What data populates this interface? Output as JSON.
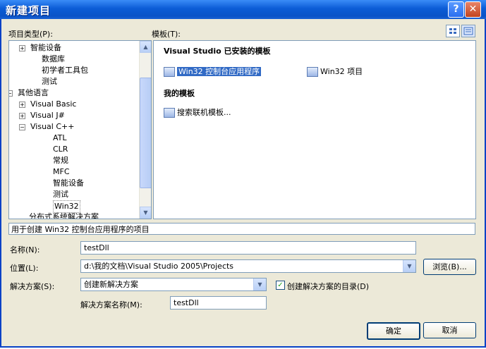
{
  "window": {
    "title": "新建项目",
    "help_symbol": "?",
    "close_symbol": "✕"
  },
  "labels": {
    "project_types": "项目类型(P):",
    "templates": "模板(T):"
  },
  "tree": [
    {
      "label": "智能设备",
      "expander": "+"
    },
    {
      "label": "数据库",
      "expander": ""
    },
    {
      "label": "初学者工具包",
      "expander": ""
    },
    {
      "label": "测试",
      "expander": ""
    },
    {
      "label": "其他语言",
      "expander": "−"
    },
    {
      "label": "Visual Basic",
      "expander": "+"
    },
    {
      "label": "Visual J#",
      "expander": "+"
    },
    {
      "label": "Visual C++",
      "expander": "−"
    },
    {
      "label": "ATL",
      "expander": ""
    },
    {
      "label": "CLR",
      "expander": ""
    },
    {
      "label": "常规",
      "expander": ""
    },
    {
      "label": "MFC",
      "expander": ""
    },
    {
      "label": "智能设备",
      "expander": ""
    },
    {
      "label": "测试",
      "expander": ""
    },
    {
      "label": "Win32",
      "expander": ""
    },
    {
      "label": "分布式系统解决方案",
      "expander": ""
    }
  ],
  "templates": {
    "installed_header": "Visual Studio 已安装的模板",
    "installed": [
      {
        "label": "Win32 控制台应用程序",
        "icon": "console-app-icon",
        "selected": true
      },
      {
        "label": "Win32 项目",
        "icon": "win32-project-icon",
        "selected": false
      }
    ],
    "my_header": "我的模板",
    "my": [
      {
        "label": "搜索联机模板...",
        "icon": "search-online-icon"
      }
    ]
  },
  "description": "用于创建 Win32 控制台应用程序的项目",
  "form": {
    "name_label": "名称(N):",
    "name_value": "testDll",
    "location_label": "位置(L):",
    "location_value": "d:\\我的文档\\Visual Studio 2005\\Projects",
    "browse_label": "浏览(B)...",
    "solution_label": "解决方案(S):",
    "solution_value": "创建新解决方案",
    "create_dir_label": "创建解决方案的目录(D)",
    "create_dir_checked": true,
    "solution_name_label": "解决方案名称(M):",
    "solution_name_value": "testDll"
  },
  "buttons": {
    "ok": "确定",
    "cancel": "取消"
  },
  "colors": {
    "title_bar": "#0b5cd6",
    "selection": "#316ac5",
    "dialog_bg": "#ece9d8"
  }
}
